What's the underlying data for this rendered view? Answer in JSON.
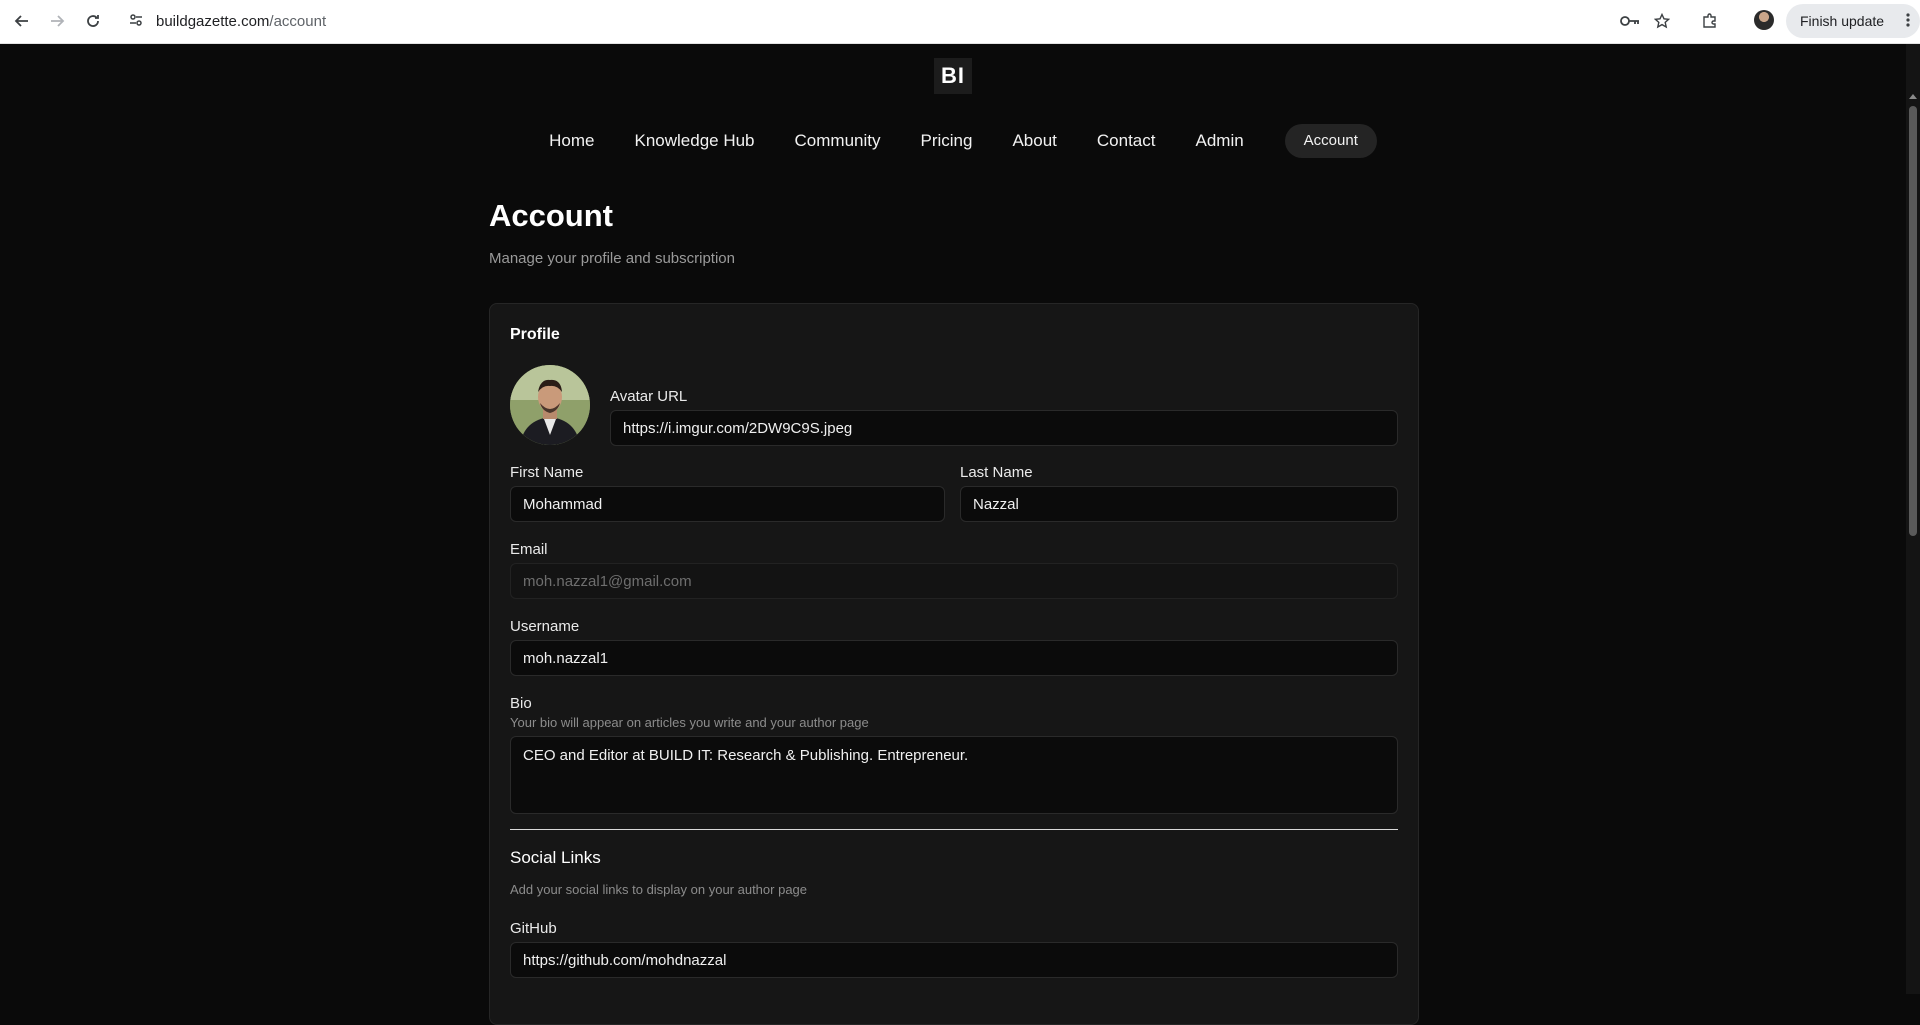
{
  "browser": {
    "url_domain": "buildgazette.com",
    "url_path": "/account",
    "finish_update_label": "Finish update"
  },
  "site": {
    "logo_text": "BI",
    "nav": [
      "Home",
      "Knowledge Hub",
      "Community",
      "Pricing",
      "About",
      "Contact",
      "Admin",
      "Account"
    ]
  },
  "page": {
    "title": "Account",
    "subtitle": "Manage your profile and subscription"
  },
  "profile": {
    "section_title": "Profile",
    "avatar_label": "Avatar URL",
    "avatar_url": "https://i.imgur.com/2DW9C9S.jpeg",
    "first_name_label": "First Name",
    "first_name": "Mohammad",
    "last_name_label": "Last Name",
    "last_name": "Nazzal",
    "email_label": "Email",
    "email": "moh.nazzal1@gmail.com",
    "username_label": "Username",
    "username": "moh.nazzal1",
    "bio_label": "Bio",
    "bio_hint": "Your bio will appear on articles you write and your author page",
    "bio": "CEO and Editor at BUILD IT: Research & Publishing. Entrepreneur."
  },
  "social": {
    "section_title": "Social Links",
    "hint": "Add your social links to display on your author page",
    "github_label": "GitHub",
    "github": "https://github.com/mohdnazzal"
  }
}
